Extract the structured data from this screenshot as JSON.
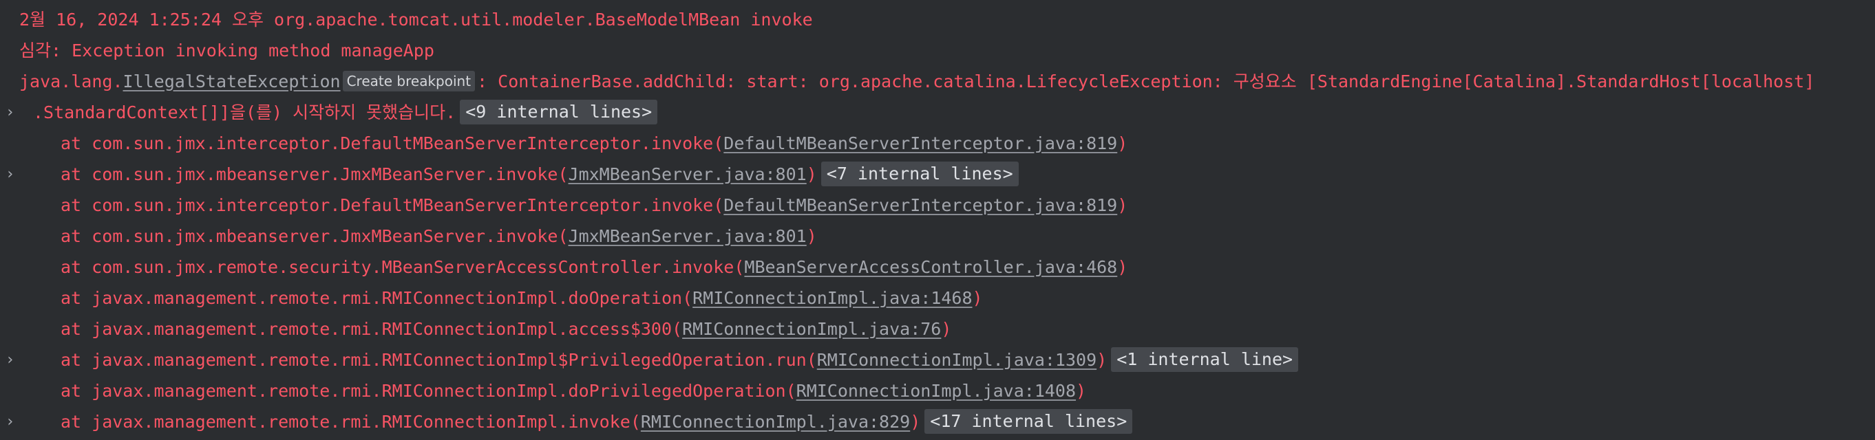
{
  "colors": {
    "background": "#2b2d30",
    "error_text": "#f75464",
    "link_text": "#a3a6ad",
    "fold_badge_bg": "#45484d"
  },
  "console": {
    "expand_glyph": "›",
    "header": {
      "line1": "2월 16, 2024 1:25:24 오후 org.apache.tomcat.util.modeler.BaseModelMBean invoke",
      "line2": "심각: Exception invoking method manageApp",
      "line3_prefix": "java.lang.",
      "line3_link": "IllegalStateException",
      "tooltip": "Create breakpoint",
      "line3_suffix": ": ContainerBase.addChild: start: org.apache.catalina.LifecycleException: 구성요소 [StandardEngine[Catalina].StandardHost[localhost]",
      "line4_text": ".StandardContext[]]을(를) 시작하지 못했습니다.",
      "line4_fold": "<9 internal lines>"
    },
    "frames": [
      {
        "prefix": "at com.sun.jmx.interceptor.DefaultMBeanServerInterceptor.invoke(",
        "link": "DefaultMBeanServerInterceptor.java:819",
        "suffix": ")",
        "fold": ""
      },
      {
        "prefix": "at com.sun.jmx.mbeanserver.JmxMBeanServer.invoke(",
        "link": "JmxMBeanServer.java:801",
        "suffix": ")",
        "fold": "<7 internal lines>"
      },
      {
        "prefix": "at com.sun.jmx.interceptor.DefaultMBeanServerInterceptor.invoke(",
        "link": "DefaultMBeanServerInterceptor.java:819",
        "suffix": ")",
        "fold": ""
      },
      {
        "prefix": "at com.sun.jmx.mbeanserver.JmxMBeanServer.invoke(",
        "link": "JmxMBeanServer.java:801",
        "suffix": ")",
        "fold": ""
      },
      {
        "prefix": "at com.sun.jmx.remote.security.MBeanServerAccessController.invoke(",
        "link": "MBeanServerAccessController.java:468",
        "suffix": ")",
        "fold": ""
      },
      {
        "prefix": "at javax.management.remote.rmi.RMIConnectionImpl.doOperation(",
        "link": "RMIConnectionImpl.java:1468",
        "suffix": ")",
        "fold": ""
      },
      {
        "prefix": "at javax.management.remote.rmi.RMIConnectionImpl.access$300(",
        "link": "RMIConnectionImpl.java:76",
        "suffix": ")",
        "fold": ""
      },
      {
        "prefix": "at javax.management.remote.rmi.RMIConnectionImpl$PrivilegedOperation.run(",
        "link": "RMIConnectionImpl.java:1309",
        "suffix": ")",
        "fold": "<1 internal line>"
      },
      {
        "prefix": "at javax.management.remote.rmi.RMIConnectionImpl.doPrivilegedOperation(",
        "link": "RMIConnectionImpl.java:1408",
        "suffix": ")",
        "fold": ""
      },
      {
        "prefix": "at javax.management.remote.rmi.RMIConnectionImpl.invoke(",
        "link": "RMIConnectionImpl.java:829",
        "suffix": ")",
        "fold": "<17 internal lines>"
      }
    ]
  }
}
